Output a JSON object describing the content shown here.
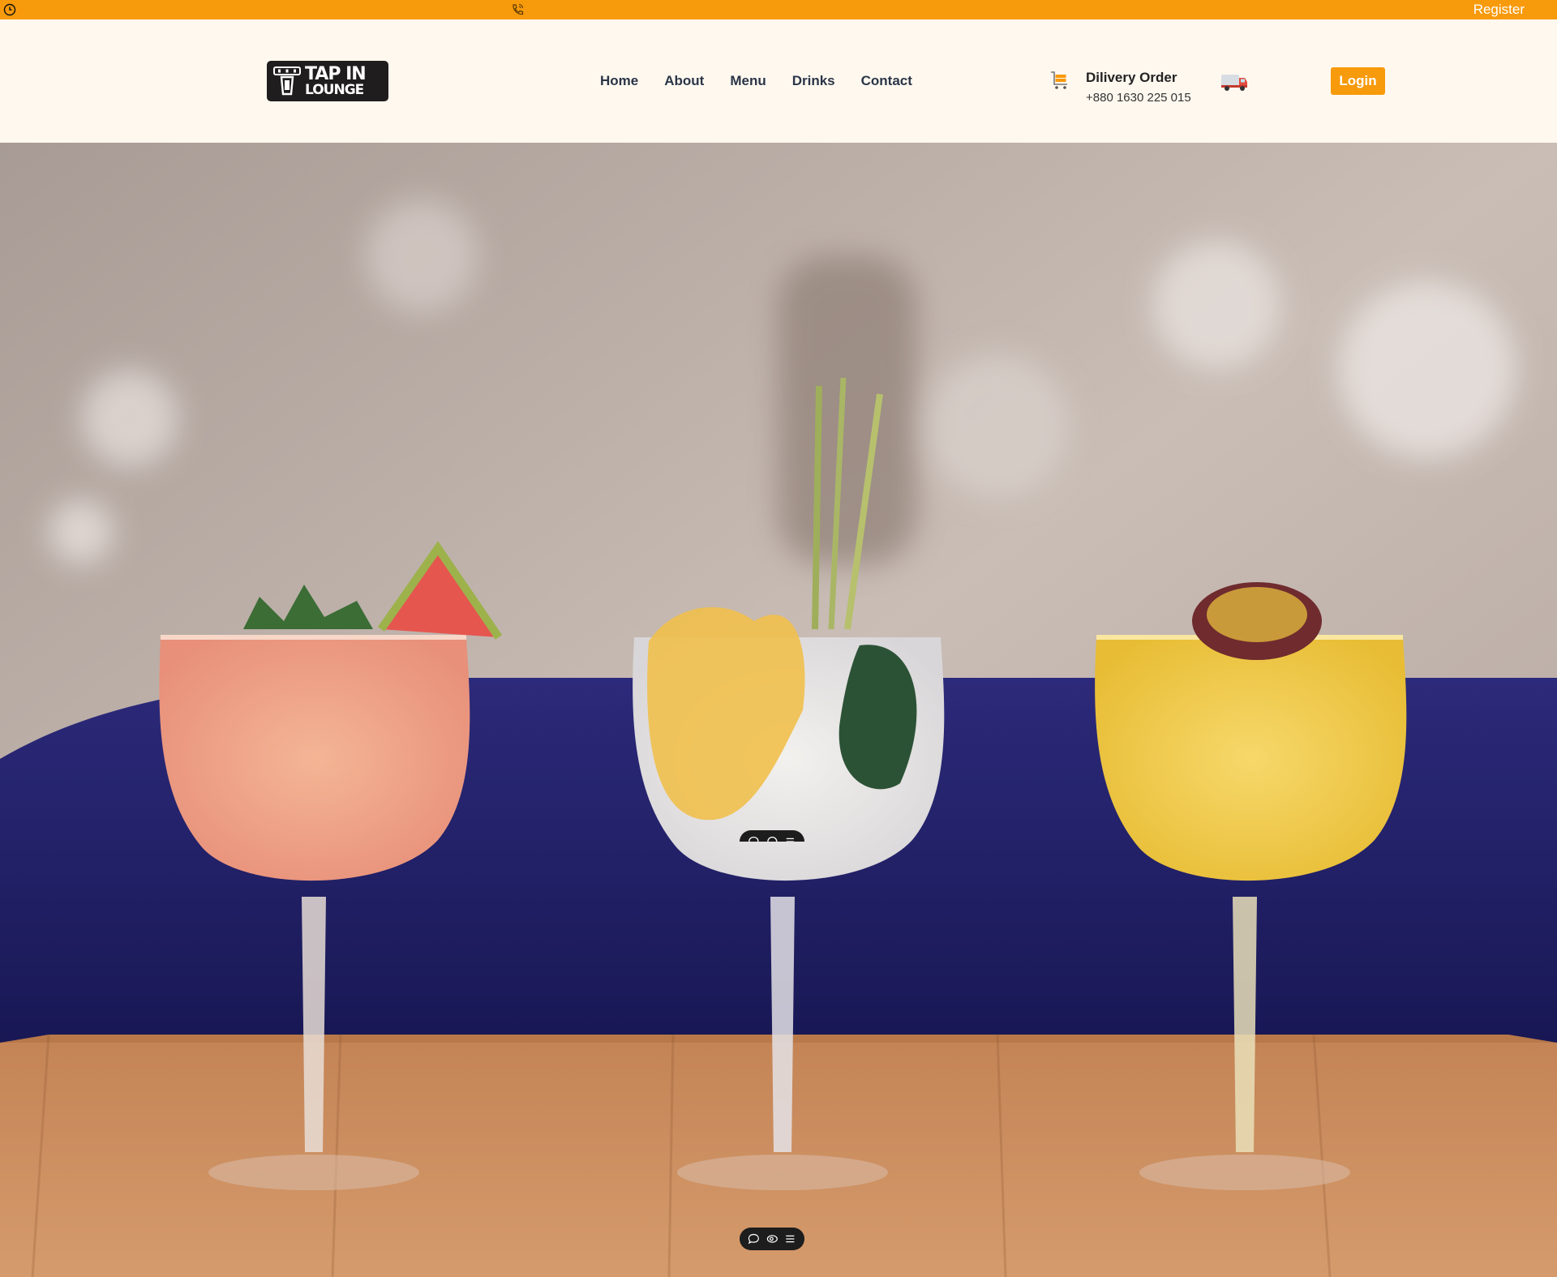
{
  "topbar": {
    "register_label": "Register",
    "clock_icon": "clock-icon",
    "phone_icon": "phone-icon",
    "bg_color": "#f79a0b"
  },
  "header": {
    "logo": {
      "line1": "TAP IN",
      "line2": "LOUNGE"
    },
    "nav": [
      {
        "label": "Home"
      },
      {
        "label": "About"
      },
      {
        "label": "Menu"
      },
      {
        "label": "Drinks"
      },
      {
        "label": "Contact"
      }
    ],
    "delivery": {
      "title": "Dilivery Order",
      "phone": "+880 1630 225 015",
      "cart_icon": "shopping-cart-icon",
      "truck_icon": "delivery-truck-icon"
    },
    "login_label": "Login",
    "accent_color": "#f79a0b"
  },
  "hero": {
    "image_alt": "three-cocktails-photo"
  },
  "toolbar_chip": {
    "icons": [
      "comment-icon",
      "view-icon",
      "list-icon"
    ]
  }
}
